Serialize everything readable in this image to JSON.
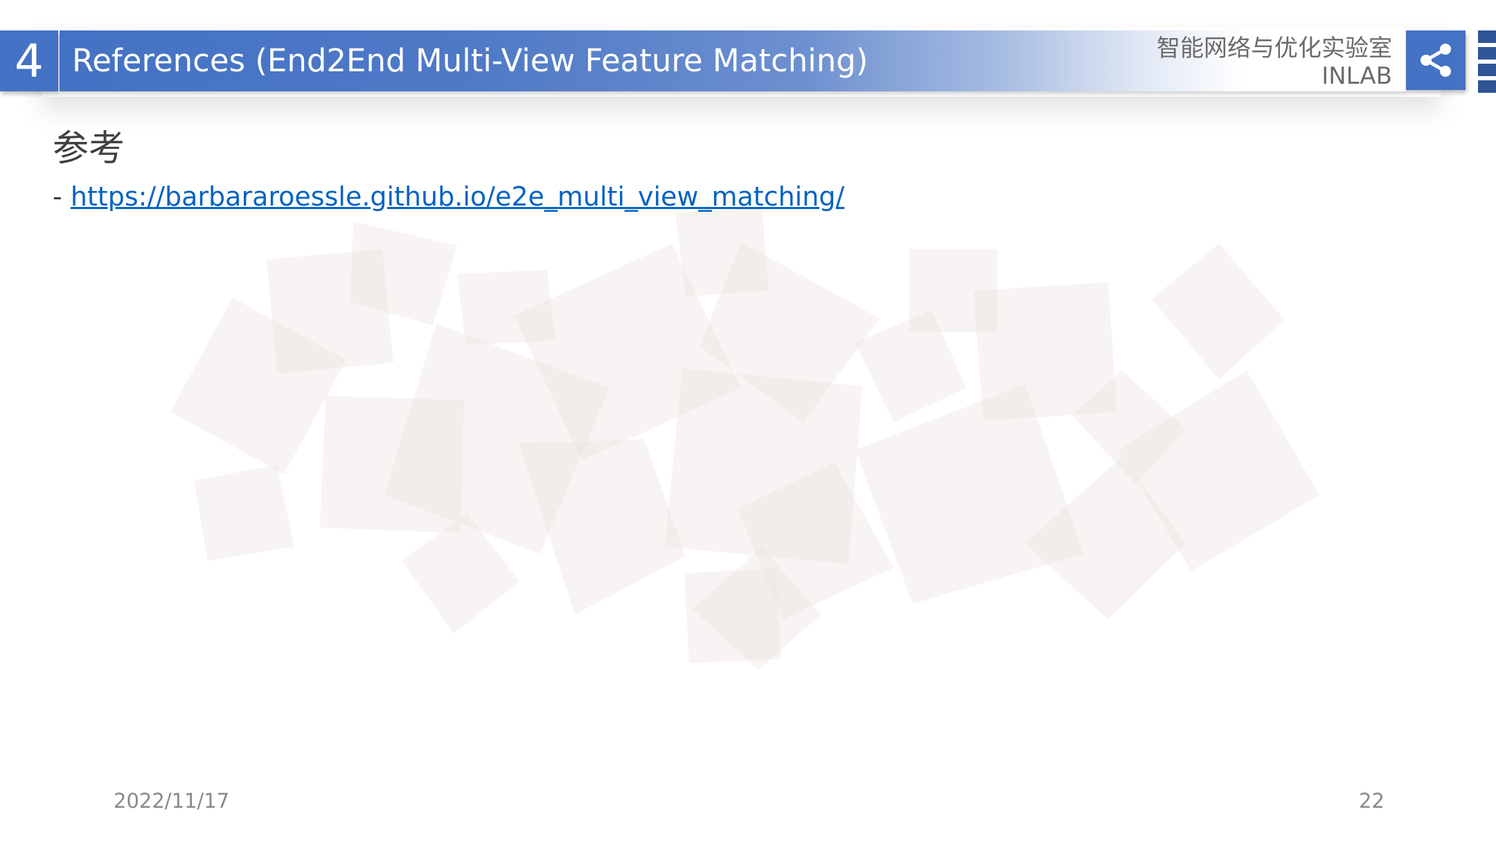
{
  "header": {
    "section_number": "4",
    "title": "References (End2End Multi-View Feature Matching)",
    "lab_name_cn": "智能网络与优化实验室",
    "lab_name_en": "INLAB",
    "share_icon": "share-icon"
  },
  "content": {
    "heading": "参考",
    "bullet": "-",
    "link_text": "https://barbararoessle.github.io/e2e_multi_view_matching/"
  },
  "footer": {
    "date": "2022/11/17",
    "page_number": "22"
  },
  "colors": {
    "accent": "#4472c4",
    "link": "#0563c1",
    "text": "#404040",
    "footer": "#8a8a8a"
  }
}
